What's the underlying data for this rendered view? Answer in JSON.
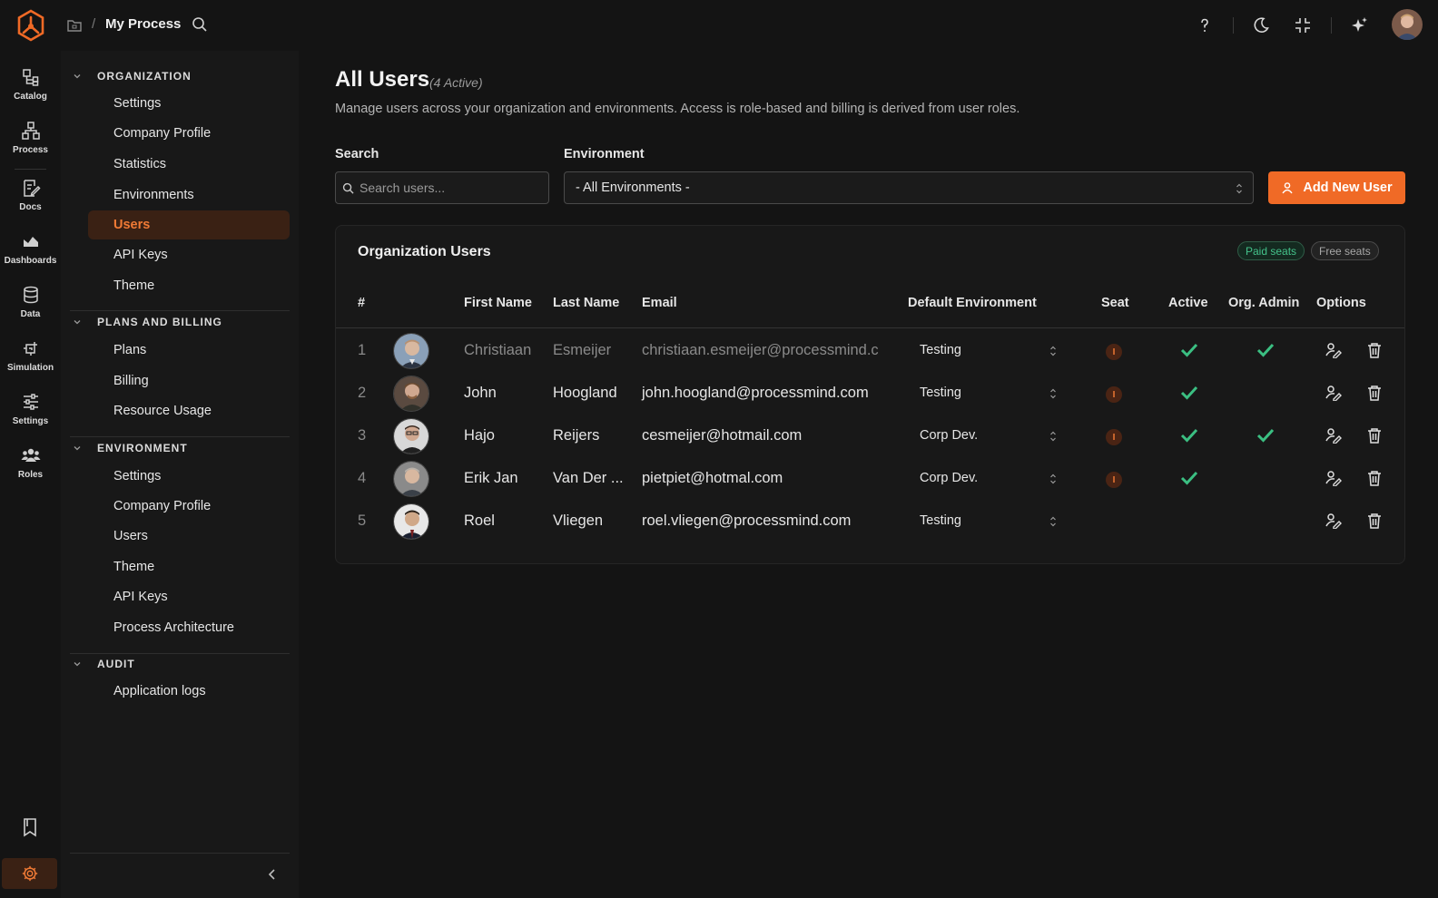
{
  "header": {
    "breadcrumb_sep": "/",
    "title": "My Process",
    "accent": "#f06a26"
  },
  "rail": {
    "items": [
      {
        "label": "Catalog",
        "icon": "catalog-icon"
      },
      {
        "label": "Process",
        "icon": "process-icon"
      },
      {
        "label": "Docs",
        "icon": "docs-icon"
      },
      {
        "label": "Dashboards",
        "icon": "dashboards-icon"
      },
      {
        "label": "Data",
        "icon": "database-icon"
      },
      {
        "label": "Simulation",
        "icon": "simulation-icon"
      },
      {
        "label": "Settings",
        "icon": "sliders-icon"
      },
      {
        "label": "Roles",
        "icon": "roles-icon"
      }
    ]
  },
  "sidebar": {
    "sections": [
      {
        "title": "ORGANIZATION",
        "items": [
          "Settings",
          "Company Profile",
          "Statistics",
          "Environments",
          "Users",
          "API Keys",
          "Theme"
        ]
      },
      {
        "title": "PLANS AND BILLING",
        "items": [
          "Plans",
          "Billing",
          "Resource Usage"
        ]
      },
      {
        "title": "ENVIRONMENT",
        "items": [
          "Settings",
          "Company Profile",
          "Users",
          "Theme",
          "API Keys",
          "Process Architecture"
        ]
      },
      {
        "title": "AUDIT",
        "items": [
          "Application logs"
        ]
      }
    ],
    "active": "Users"
  },
  "main": {
    "title": "All Users",
    "count": "(4 Active)",
    "subtitle": "Manage users across your organization and environments. Access is role-based and billing is derived from user roles.",
    "search_label": "Search",
    "search_placeholder": "Search users...",
    "environment_label": "Environment",
    "environment_value": "- All Environments -",
    "add_button": "Add New User"
  },
  "card": {
    "title": "Organization Users",
    "chip_paid": "Paid seats",
    "chip_free": "Free seats",
    "columns": [
      "#",
      "First Name",
      "Last Name",
      "Email",
      "Default Environment",
      "Seat",
      "Active",
      "Org. Admin",
      "Options"
    ],
    "rows": [
      {
        "num": "1",
        "first": "Christiaan",
        "last": "Esmeijer",
        "email": "christiaan.esmeijer@processmind.c",
        "env": "Testing",
        "seat": "I",
        "active": true,
        "admin": true,
        "dim": true
      },
      {
        "num": "2",
        "first": "John",
        "last": "Hoogland",
        "email": "john.hoogland@processmind.com",
        "env": "Testing",
        "seat": "I",
        "active": true,
        "admin": false,
        "dim": false
      },
      {
        "num": "3",
        "first": "Hajo",
        "last": "Reijers",
        "email": "cesmeijer@hotmail.com",
        "env": "Corp Dev.",
        "seat": "I",
        "active": true,
        "admin": true,
        "dim": false
      },
      {
        "num": "4",
        "first": "Erik Jan",
        "last": "Van Der ...",
        "email": "pietpiet@hotmal.com",
        "env": "Corp Dev.",
        "seat": "I",
        "active": true,
        "admin": false,
        "dim": false
      },
      {
        "num": "5",
        "first": "Roel",
        "last": "Vliegen",
        "email": "roel.vliegen@processmind.com",
        "env": "Testing",
        "seat": "",
        "active": false,
        "admin": false,
        "dim": false
      }
    ]
  }
}
